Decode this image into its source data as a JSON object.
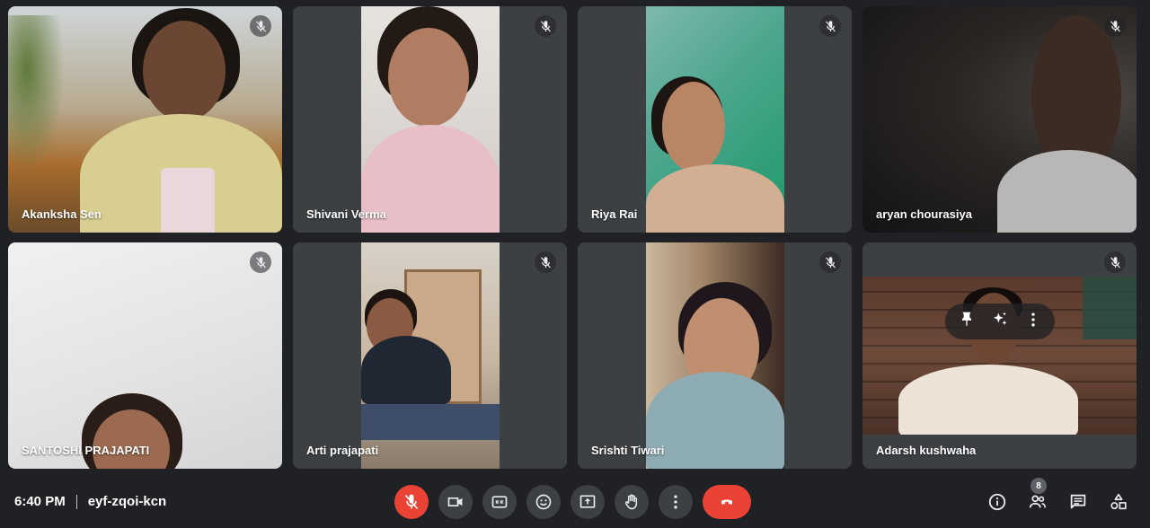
{
  "participants": [
    {
      "name": "Akanksha Sen",
      "muted": true
    },
    {
      "name": "Shivani Verma",
      "muted": true
    },
    {
      "name": "Riya Rai",
      "muted": true
    },
    {
      "name": "aryan chourasiya",
      "muted": true
    },
    {
      "name": "SANTOSHI PRAJAPATI",
      "muted": true
    },
    {
      "name": "Arti prajapati",
      "muted": true
    },
    {
      "name": "Srishti Tiwari",
      "muted": true
    },
    {
      "name": "Adarsh kushwaha",
      "muted": true
    }
  ],
  "tile_overlay": {
    "icons": [
      "pin-icon",
      "sparkle-effects-icon",
      "more-vert-icon"
    ]
  },
  "meeting": {
    "time": "6:40 PM",
    "code": "eyf-zqoi-kcn"
  },
  "controls": [
    "mic-off-icon",
    "videocam-icon",
    "captions-icon",
    "emoji-icon",
    "present-icon",
    "raise-hand-icon",
    "more-vert-icon",
    "call-end-icon"
  ],
  "side_panel": {
    "participant_count": "8",
    "icons": [
      "info-icon",
      "people-icon",
      "chat-icon",
      "activities-icon"
    ]
  },
  "colors": {
    "background": "#202124",
    "tile": "#3c4043",
    "danger": "#ea4335",
    "text": "#e8eaed"
  }
}
